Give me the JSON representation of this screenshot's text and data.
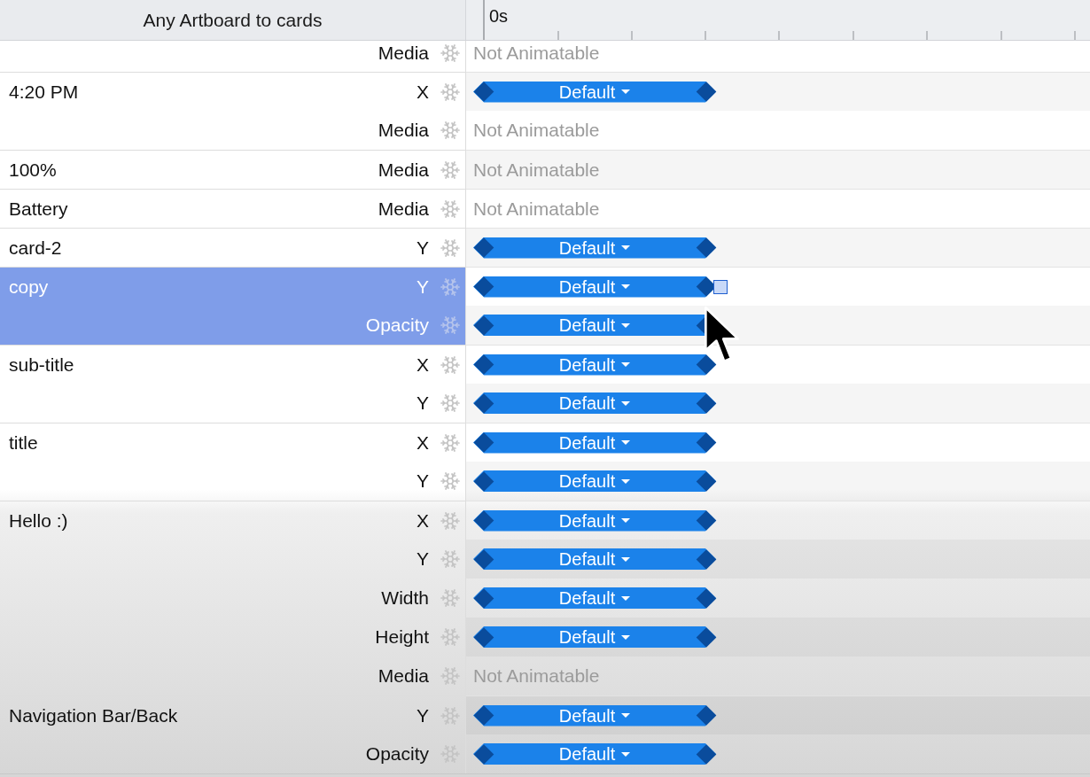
{
  "header": {
    "title": "Any Artboard to cards",
    "time_label": "0s"
  },
  "layers": [
    {
      "selected": false,
      "properties": [
        {
          "label": "Media",
          "kind": "static",
          "value": "Not Animatable"
        }
      ]
    },
    {
      "name": "4:20 PM",
      "selected": false,
      "properties": [
        {
          "label": "X",
          "kind": "keyframe",
          "value": "Default"
        },
        {
          "label": "Media",
          "kind": "static",
          "value": "Not Animatable"
        }
      ]
    },
    {
      "name": "100%",
      "selected": false,
      "properties": [
        {
          "label": "Media",
          "kind": "static",
          "value": "Not Animatable"
        }
      ]
    },
    {
      "name": "Battery",
      "selected": false,
      "properties": [
        {
          "label": "Media",
          "kind": "static",
          "value": "Not Animatable"
        }
      ]
    },
    {
      "name": "card-2",
      "selected": false,
      "properties": [
        {
          "label": "Y",
          "kind": "keyframe",
          "value": "Default"
        }
      ]
    },
    {
      "name": "copy",
      "selected": true,
      "properties": [
        {
          "label": "Y",
          "kind": "keyframe",
          "value": "Default",
          "handle": true
        },
        {
          "label": "Opacity",
          "kind": "keyframe",
          "value": "Default"
        }
      ]
    },
    {
      "name": "sub-title",
      "selected": false,
      "properties": [
        {
          "label": "X",
          "kind": "keyframe",
          "value": "Default"
        },
        {
          "label": "Y",
          "kind": "keyframe",
          "value": "Default"
        }
      ]
    },
    {
      "name": "title",
      "selected": false,
      "properties": [
        {
          "label": "X",
          "kind": "keyframe",
          "value": "Default"
        },
        {
          "label": "Y",
          "kind": "keyframe",
          "value": "Default"
        }
      ]
    },
    {
      "name": "Hello :)",
      "selected": false,
      "properties": [
        {
          "label": "X",
          "kind": "keyframe",
          "value": "Default"
        },
        {
          "label": "Y",
          "kind": "keyframe",
          "value": "Default"
        },
        {
          "label": "Width",
          "kind": "keyframe",
          "value": "Default"
        },
        {
          "label": "Height",
          "kind": "keyframe",
          "value": "Default"
        },
        {
          "label": "Media",
          "kind": "static",
          "value": "Not Animatable"
        }
      ]
    },
    {
      "name": "Navigation Bar/Back",
      "selected": false,
      "properties": [
        {
          "label": "Y",
          "kind": "keyframe",
          "value": "Default"
        },
        {
          "label": "Opacity",
          "kind": "keyframe",
          "value": "Default"
        }
      ]
    }
  ]
}
